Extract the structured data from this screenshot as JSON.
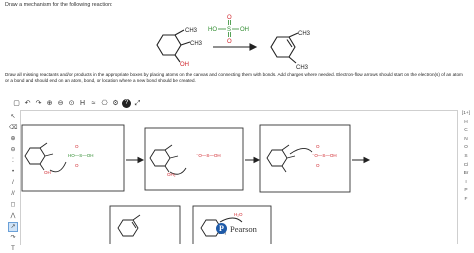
{
  "prompt": "Draw a mechanism for the following reaction:",
  "reaction": {
    "reagent_left": "HO",
    "reagent_s": "S",
    "reagent_right": "OH",
    "reagent_top_o": "O",
    "reagent_bottom_o": "O",
    "sm_ch3_a": "CH3",
    "sm_ch3_b": "CH3",
    "sm_oh": "OH",
    "prod_ch3_a": "CH3",
    "prod_ch3_b": "CH3",
    "reagent_color": "#2e8b2e",
    "oh_color": "#d0232a"
  },
  "instructions": "Draw all missing reactants and/or products in the appropriate boxes by placing atoms on the canvas and connecting them with bonds. Add charges where needed. Electron-flow arrows should start on the electron(s) of an atom or a bond and should end on an atom, bond, or location where a new bond should be created.",
  "toolbar": {
    "items": [
      {
        "icon": "new-document-icon",
        "glyph": "▢"
      },
      {
        "icon": "undo-icon",
        "glyph": "↶"
      },
      {
        "icon": "redo-icon",
        "glyph": "↷"
      },
      {
        "icon": "zoom-in-icon",
        "glyph": "⊕"
      },
      {
        "icon": "zoom-out-icon",
        "glyph": "⊖"
      },
      {
        "icon": "zoom-fit-icon",
        "glyph": "⊙"
      },
      {
        "icon": "label-icon",
        "glyph": "H"
      },
      {
        "icon": "clean-icon",
        "glyph": "≈"
      },
      {
        "icon": "template-icon",
        "glyph": "⎔"
      },
      {
        "icon": "settings-icon",
        "glyph": "⚙"
      },
      {
        "icon": "help-icon",
        "glyph": "?"
      },
      {
        "icon": "expand-icon",
        "glyph": "⤢"
      }
    ]
  },
  "left_tools": [
    {
      "icon": "select-icon",
      "glyph": "↖"
    },
    {
      "icon": "eraser-icon",
      "glyph": "⌫"
    },
    {
      "icon": "plus-charge-icon",
      "glyph": "⊕"
    },
    {
      "icon": "minus-charge-icon",
      "glyph": "⊖"
    },
    {
      "icon": "lone-pair-icon",
      "glyph": "⁚"
    },
    {
      "icon": "radical-icon",
      "glyph": "•"
    },
    {
      "icon": "bond-icon",
      "glyph": "/"
    },
    {
      "icon": "double-bond-icon",
      "glyph": "//"
    },
    {
      "icon": "ring-icon",
      "glyph": "◻"
    },
    {
      "icon": "chain-icon",
      "glyph": "⋀"
    },
    {
      "icon": "arrow-icon",
      "glyph": "↗"
    },
    {
      "icon": "curved-arrow-icon",
      "glyph": "↷"
    },
    {
      "icon": "text-icon",
      "glyph": "T"
    }
  ],
  "elements": [
    "H",
    "C",
    "N",
    "O",
    "S",
    "Cl",
    "Br",
    "I",
    "P",
    "F"
  ],
  "element_palette_header": "[1+]",
  "footer": {
    "brand": "Pearson",
    "logo_letter": "P"
  }
}
